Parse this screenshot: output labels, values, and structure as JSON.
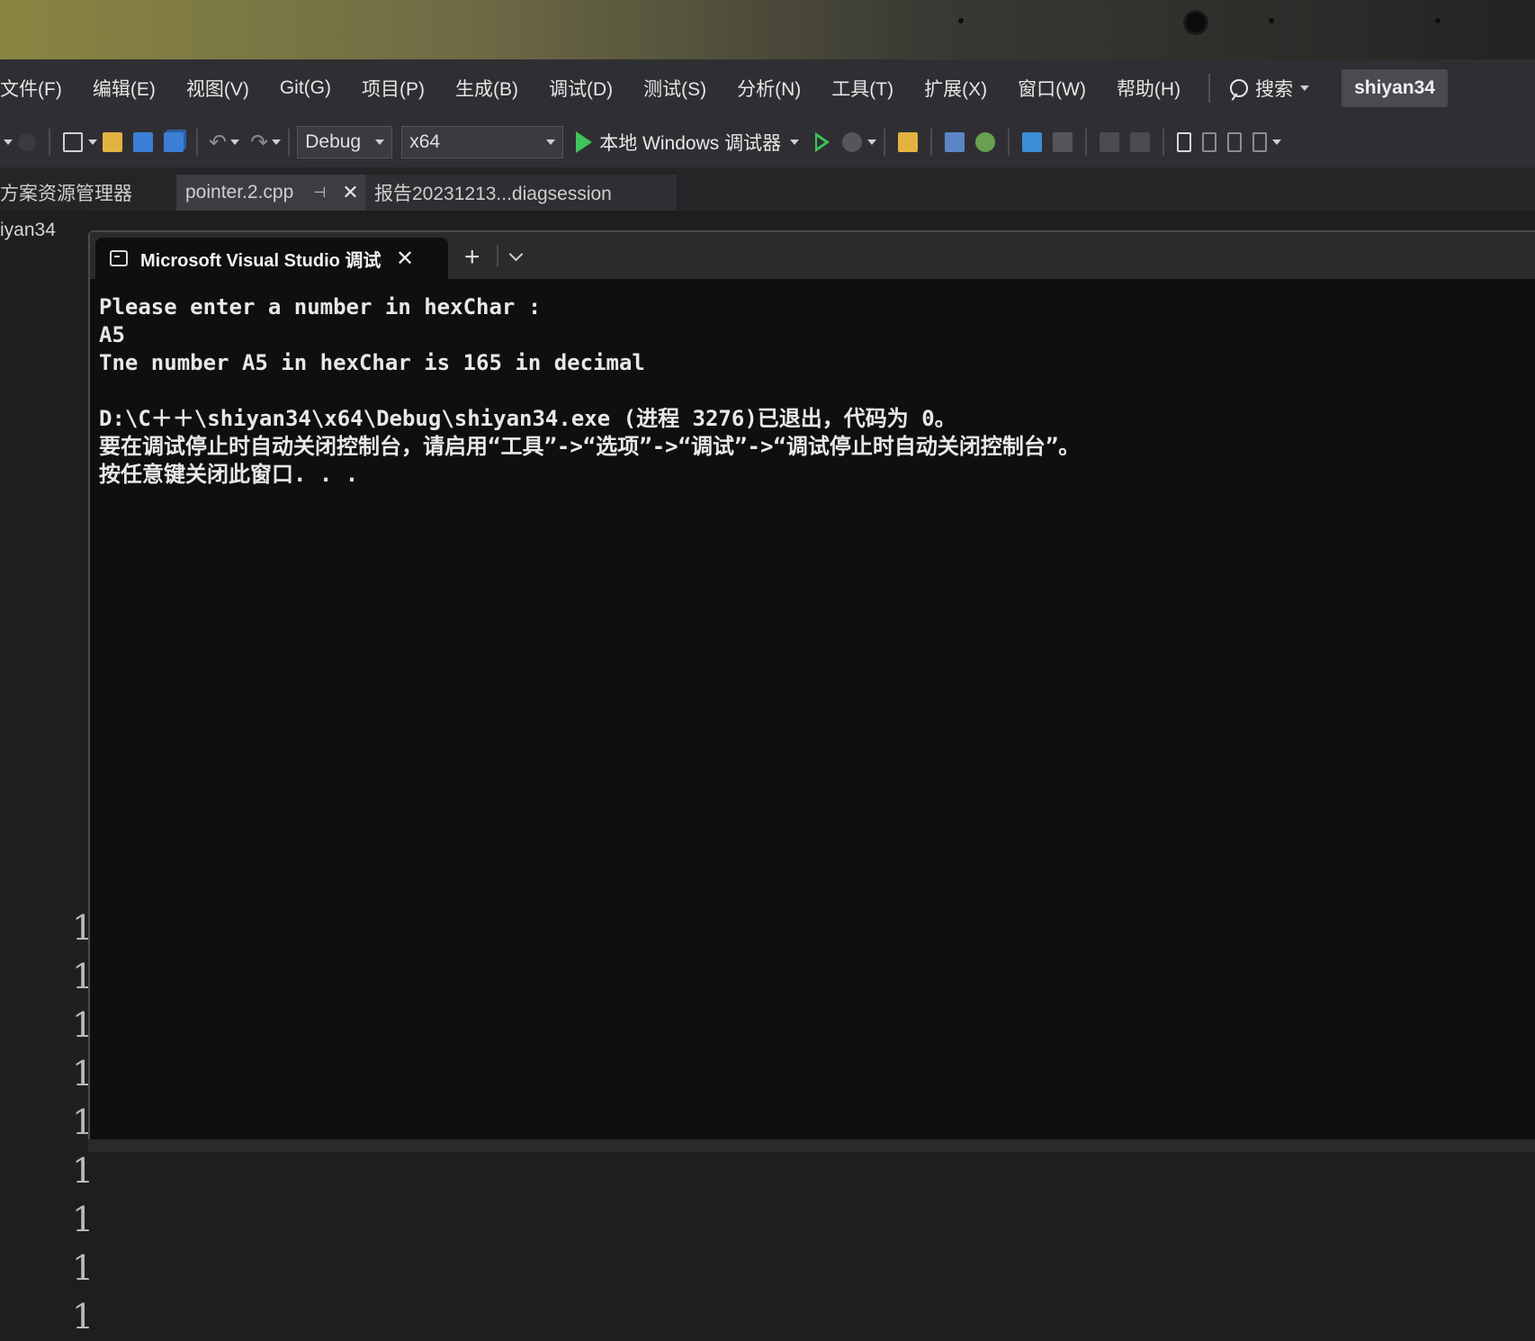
{
  "menubar": {
    "items": [
      "文件(F)",
      "编辑(E)",
      "视图(V)",
      "Git(G)",
      "项目(P)",
      "生成(B)",
      "调试(D)",
      "测试(S)",
      "分析(N)",
      "工具(T)",
      "扩展(X)",
      "窗口(W)",
      "帮助(H)"
    ],
    "search_label": "搜索",
    "user": "shiyan34"
  },
  "toolbar": {
    "config": "Debug",
    "platform": "x64",
    "run_label": "本地 Windows 调试器"
  },
  "doc_tabs": {
    "explorer": "方案资源管理器",
    "active": "pointer.2.cpp",
    "other": "报告20231213...diagsession"
  },
  "left_panel": {
    "project": "iyan34",
    "line_numbers": [
      "1",
      "1",
      "1",
      "1",
      "1",
      "1",
      "1",
      "1",
      "1"
    ]
  },
  "terminal": {
    "tab_title": "Microsoft Visual Studio 调试控制台",
    "close_glyph": "✕",
    "new_tab_glyph": "+",
    "lines": [
      "Please enter a number in hexChar :",
      "A5",
      "Tne number A5 in hexChar is 165 in decimal",
      "",
      "D:\\C＋＋\\shiyan34\\x64\\Debug\\shiyan34.exe (进程 3276)已退出，代码为 0。",
      "要在调试停止时自动关闭控制台，请启用“工具”->“选项”->“调试”->“调试停止时自动关闭控制台”。",
      "按任意键关闭此窗口. . ."
    ]
  },
  "colors": {
    "ide_chrome": "#2f2f33",
    "console_bg": "#0f0f10",
    "console_text": "#e8e8e8",
    "run_green": "#3fc35a"
  }
}
